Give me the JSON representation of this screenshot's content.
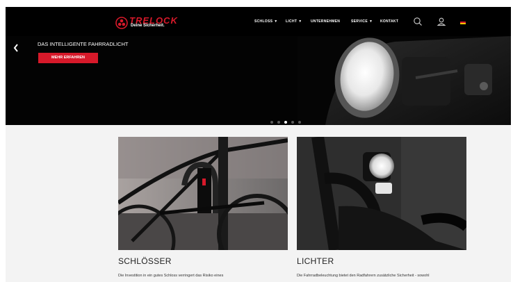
{
  "header": {
    "brand": "TRELOCK",
    "tagline": "Deine Sicherheit.",
    "nav": [
      {
        "label": "SCHLOSS",
        "dropdown": true
      },
      {
        "label": "LICHT",
        "dropdown": true
      },
      {
        "label": "UNTERNEHMEN",
        "dropdown": false
      },
      {
        "label": "SERVICE",
        "dropdown": true
      },
      {
        "label": "KONTAKT",
        "dropdown": false
      }
    ],
    "icons": [
      "search-icon",
      "user-icon",
      "german-flag-icon"
    ]
  },
  "hero": {
    "title": "DAS INTELLIGENTE FAHRRADLICHT",
    "button_label": "MEHR ERFAHREN",
    "slides": 5,
    "active_slide": 3
  },
  "cards": [
    {
      "title": "SCHLÖSSER",
      "text": "Die Investition in ein gutes Schloss verringert das Risiko eines"
    },
    {
      "title": "LICHTER",
      "text": "Die Fahrradbeleuchtung bietet den Radfahrern zusätzliche Sicherheit - sowohl"
    }
  ],
  "colors": {
    "accent": "#d7192a",
    "header_bg": "#000000",
    "page_bg": "#f3f3f3"
  }
}
